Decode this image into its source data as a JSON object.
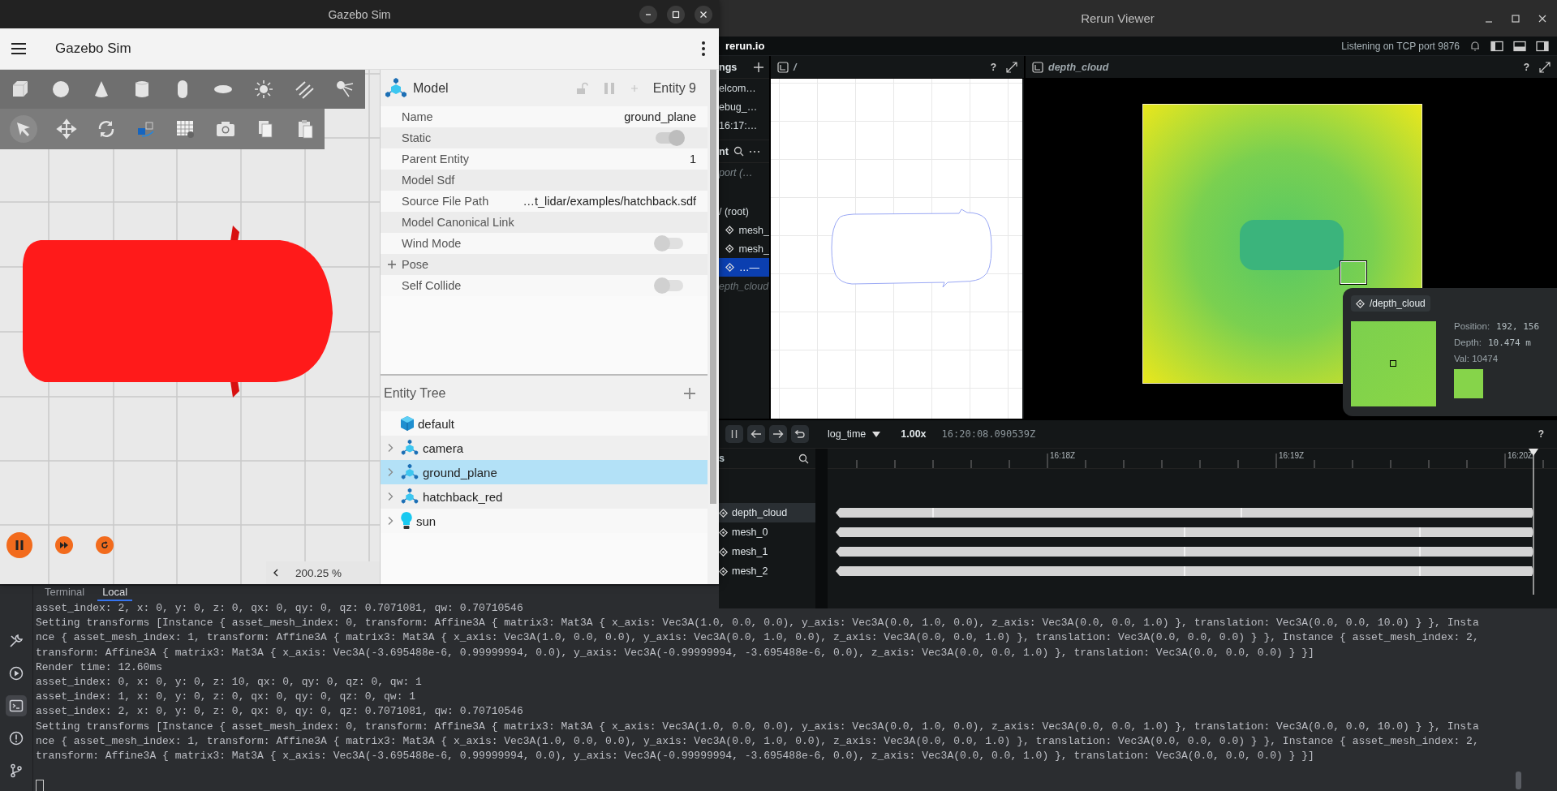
{
  "gazebo": {
    "window_title": "Gazebo Sim",
    "app_title": "Gazebo Sim",
    "component": {
      "title": "Model",
      "entity": "Entity 9"
    },
    "properties": [
      {
        "kind": "text",
        "label": "Name",
        "value": "ground_plane"
      },
      {
        "kind": "toggle",
        "label": "Static",
        "on": true
      },
      {
        "kind": "text",
        "label": "Parent Entity",
        "value": "1"
      },
      {
        "kind": "label",
        "label": "Model Sdf"
      },
      {
        "kind": "text",
        "label": "Source File Path",
        "value": "…t_lidar/examples/hatchback.sdf"
      },
      {
        "kind": "label",
        "label": "Model Canonical Link"
      },
      {
        "kind": "toggle",
        "label": "Wind Mode",
        "on": false
      },
      {
        "kind": "group",
        "label": "Pose",
        "expanded": false
      },
      {
        "kind": "toggle",
        "label": "Self Collide",
        "on": false
      }
    ],
    "entity_tree": {
      "title": "Entity Tree",
      "items": [
        {
          "name": "default",
          "kind": "cube",
          "expandable": false,
          "selected": false
        },
        {
          "name": "camera",
          "kind": "model",
          "expandable": true,
          "selected": false
        },
        {
          "name": "ground_plane",
          "kind": "model",
          "expandable": true,
          "selected": true
        },
        {
          "name": "hatchback_red",
          "kind": "model",
          "expandable": true,
          "selected": false
        },
        {
          "name": "sun",
          "kind": "light",
          "expandable": true,
          "selected": false
        }
      ]
    },
    "zoom": "200.25 %"
  },
  "rerun": {
    "window_title": "Rerun Viewer",
    "brand": "rerun.io",
    "status": "Listening on TCP port 9876",
    "left_panel": {
      "recordings_header": "ngs",
      "recordings": [
        "elcom…",
        "ebug_…",
        "16:17:…"
      ],
      "blueprint_header": "nt",
      "blueprint_view": "port (…",
      "root": "/ (root)",
      "entities": [
        {
          "label": "mesh_",
          "selected": false
        },
        {
          "label": "mesh_",
          "selected": false
        },
        {
          "label": "…—",
          "selected": true
        }
      ],
      "extra_entry": "epth_cloud"
    },
    "views": [
      {
        "title": "/",
        "kind": "spatial2d",
        "help": "?"
      },
      {
        "title": "depth_cloud",
        "kind": "depth",
        "help": "?"
      }
    ],
    "hover": {
      "entity": "/depth_cloud",
      "fields": [
        {
          "label": "Position:",
          "value": "192, 156"
        },
        {
          "label": "Depth:",
          "value": "10.474 m"
        }
      ],
      "value_text": "Val: 10474"
    },
    "timeline": {
      "timeline": "log_time",
      "speed": "1.00x",
      "time": "16:20:08.090539Z",
      "help": "?",
      "streams_header": "s",
      "ruler": [
        "16:18Z",
        "16:19Z",
        "16:20Z"
      ],
      "streams": [
        {
          "name": "depth_cloud",
          "selected": true
        },
        {
          "name": "mesh_0",
          "selected": false
        },
        {
          "name": "mesh_1",
          "selected": false
        },
        {
          "name": "mesh_2",
          "selected": false
        }
      ]
    }
  },
  "terminal": {
    "tabs": [
      {
        "label": "Terminal",
        "selected": false
      },
      {
        "label": "Local",
        "selected": true
      }
    ],
    "tools": [
      {
        "kind": "build",
        "selected": false
      },
      {
        "kind": "run",
        "selected": false
      },
      {
        "kind": "terminal",
        "selected": true
      },
      {
        "kind": "problems",
        "selected": false
      },
      {
        "kind": "git",
        "selected": false
      }
    ],
    "lines": [
      "asset_index: 2, x: 0, y: 0, z: 0, qx: 0, qy: 0, qz: 0.7071081, qw: 0.70710546",
      "Setting transforms [Instance { asset_mesh_index: 0, transform: Affine3A { matrix3: Mat3A { x_axis: Vec3A(1.0, 0.0, 0.0), y_axis: Vec3A(0.0, 1.0, 0.0), z_axis: Vec3A(0.0, 0.0, 1.0) }, translation: Vec3A(0.0, 0.0, 10.0) } }, Insta",
      "nce { asset_mesh_index: 1, transform: Affine3A { matrix3: Mat3A { x_axis: Vec3A(1.0, 0.0, 0.0), y_axis: Vec3A(0.0, 1.0, 0.0), z_axis: Vec3A(0.0, 0.0, 1.0) }, translation: Vec3A(0.0, 0.0, 0.0) } }, Instance { asset_mesh_index: 2,",
      "transform: Affine3A { matrix3: Mat3A { x_axis: Vec3A(-3.695488e-6, 0.99999994, 0.0), y_axis: Vec3A(-0.99999994, -3.695488e-6, 0.0), z_axis: Vec3A(0.0, 0.0, 1.0) }, translation: Vec3A(0.0, 0.0, 0.0) } }]",
      "Render time: 12.60ms",
      "asset_index: 0, x: 0, y: 0, z: 10, qx: 0, qy: 0, qz: 0, qw: 1",
      "asset_index: 1, x: 0, y: 0, z: 0, qx: 0, qy: 0, qz: 0, qw: 1",
      "asset_index: 2, x: 0, y: 0, z: 0, qx: 0, qy: 0, qz: 0.7071081, qw: 0.70710546",
      "Setting transforms [Instance { asset_mesh_index: 0, transform: Affine3A { matrix3: Mat3A { x_axis: Vec3A(1.0, 0.0, 0.0), y_axis: Vec3A(0.0, 1.0, 0.0), z_axis: Vec3A(0.0, 0.0, 1.0) }, translation: Vec3A(0.0, 0.0, 10.0) } }, Insta",
      "nce { asset_mesh_index: 1, transform: Affine3A { matrix3: Mat3A { x_axis: Vec3A(1.0, 0.0, 0.0), y_axis: Vec3A(0.0, 1.0, 0.0), z_axis: Vec3A(0.0, 0.0, 1.0) }, translation: Vec3A(0.0, 0.0, 0.0) } }, Instance { asset_mesh_index: 2,",
      "transform: Affine3A { matrix3: Mat3A { x_axis: Vec3A(-3.695488e-6, 0.99999994, 0.0), y_axis: Vec3A(-0.99999994, -3.695488e-6, 0.0), z_axis: Vec3A(0.0, 0.0, 1.0) }, translation: Vec3A(0.0, 0.0, 0.0) } }]"
    ]
  }
}
